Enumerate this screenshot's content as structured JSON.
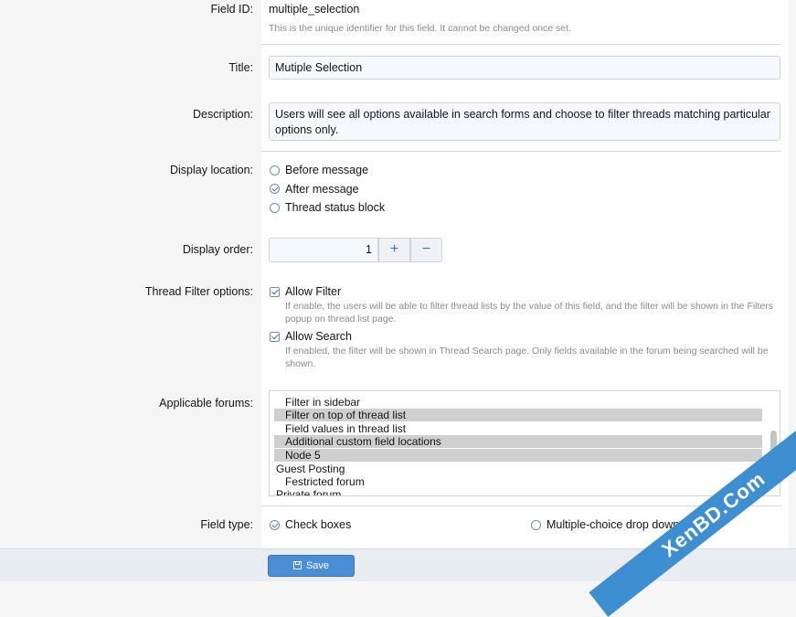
{
  "field_id": {
    "label": "Field ID:",
    "value": "multiple_selection",
    "hint": "This is the unique identifier for this field. It cannot be changed once set."
  },
  "title": {
    "label": "Title:",
    "value": "Mutiple Selection"
  },
  "description": {
    "label": "Description:",
    "value": "Users will see all options available in search forms and choose to filter threads matching particular options only."
  },
  "display_location": {
    "label": "Display location:",
    "options": [
      {
        "label": "Before message",
        "checked": false
      },
      {
        "label": "After message",
        "checked": true
      },
      {
        "label": "Thread status block",
        "checked": false
      }
    ]
  },
  "display_order": {
    "label": "Display order:",
    "value": "1",
    "plus": "+",
    "minus": "−"
  },
  "thread_filter": {
    "label": "Thread Filter options:",
    "options": [
      {
        "label": "Allow Filter",
        "checked": true,
        "hint": "If enable, the users will be able to filter thread lists by the value of this field, and the filter will be shown in the Filters popup on thread list page."
      },
      {
        "label": "Allow Search",
        "checked": true,
        "hint": "If enabled, the filter will be shown in Thread Search page. Only fields available in the forum being searched will be shown."
      }
    ]
  },
  "applicable_forums": {
    "label": "Applicable forums:",
    "items": [
      {
        "label": "Filter in sidebar",
        "selected": false,
        "indent": true
      },
      {
        "label": "Filter on top of thread list",
        "selected": true,
        "indent": true
      },
      {
        "label": "Field values in thread list",
        "selected": false,
        "indent": true
      },
      {
        "label": "Additional custom field locations",
        "selected": true,
        "indent": true
      },
      {
        "label": "Node 5",
        "selected": true,
        "indent": true
      },
      {
        "label": "Guest Posting",
        "selected": false,
        "indent": false
      },
      {
        "label": "Festricted forum",
        "selected": false,
        "indent": true
      },
      {
        "label": "Private forum",
        "selected": false,
        "indent": false
      }
    ]
  },
  "field_type": {
    "label": "Field type:",
    "options": [
      {
        "label": "Check boxes",
        "checked": true
      },
      {
        "label": "Multiple-choice drop down",
        "checked": false
      }
    ]
  },
  "footer": {
    "save_label": "Save"
  },
  "watermark": "XenBD.Com",
  "colors": {
    "accent": "#4a8fd6",
    "selected_item": "#cfcfcf",
    "input_bg": "#f5f8fc"
  }
}
